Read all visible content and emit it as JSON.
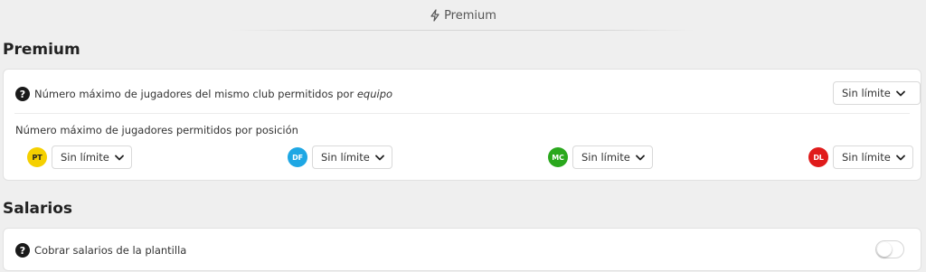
{
  "header": {
    "title": "Premium",
    "icon": "bolt-icon"
  },
  "premium_section": {
    "title": "Premium",
    "club_limit": {
      "label_prefix": "Número máximo de jugadores del mismo club permitidos por",
      "label_emphasis": "equipo",
      "value": "Sin límite"
    },
    "position_limit": {
      "label": "Número máximo de jugadores permitidos por posición",
      "positions": [
        {
          "code": "PT",
          "value": "Sin límite",
          "color": "#f5d000",
          "text_color": "#222222"
        },
        {
          "code": "DF",
          "value": "Sin límite",
          "color": "#1ea7e4",
          "text_color": "#ffffff"
        },
        {
          "code": "MC",
          "value": "Sin límite",
          "color": "#2aa81d",
          "text_color": "#ffffff"
        },
        {
          "code": "DL",
          "value": "Sin límite",
          "color": "#e01b1b",
          "text_color": "#ffffff"
        }
      ]
    }
  },
  "salarios_section": {
    "title": "Salarios",
    "charge_salaries": {
      "label": "Cobrar salarios de la plantilla",
      "enabled": false
    }
  },
  "help_glyph": "?"
}
